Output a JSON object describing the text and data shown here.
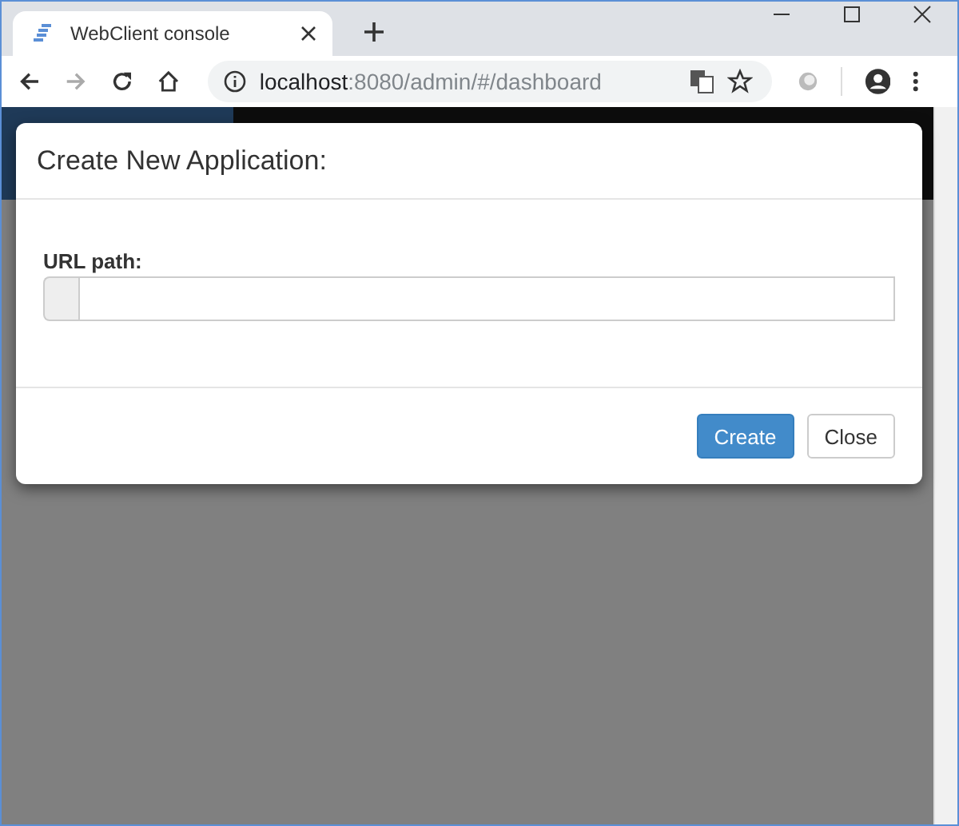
{
  "browser": {
    "tab": {
      "title": "WebClient console",
      "selected": true
    },
    "address": {
      "host": "localhost",
      "path": ":8080/admin/#/dashboard"
    }
  },
  "modal": {
    "title": "Create New Application:",
    "field": {
      "label": "URL path:"
    },
    "buttons": [
      {
        "label": "Create",
        "kind": "primary"
      },
      {
        "label": "Close",
        "kind": "default"
      }
    ]
  }
}
